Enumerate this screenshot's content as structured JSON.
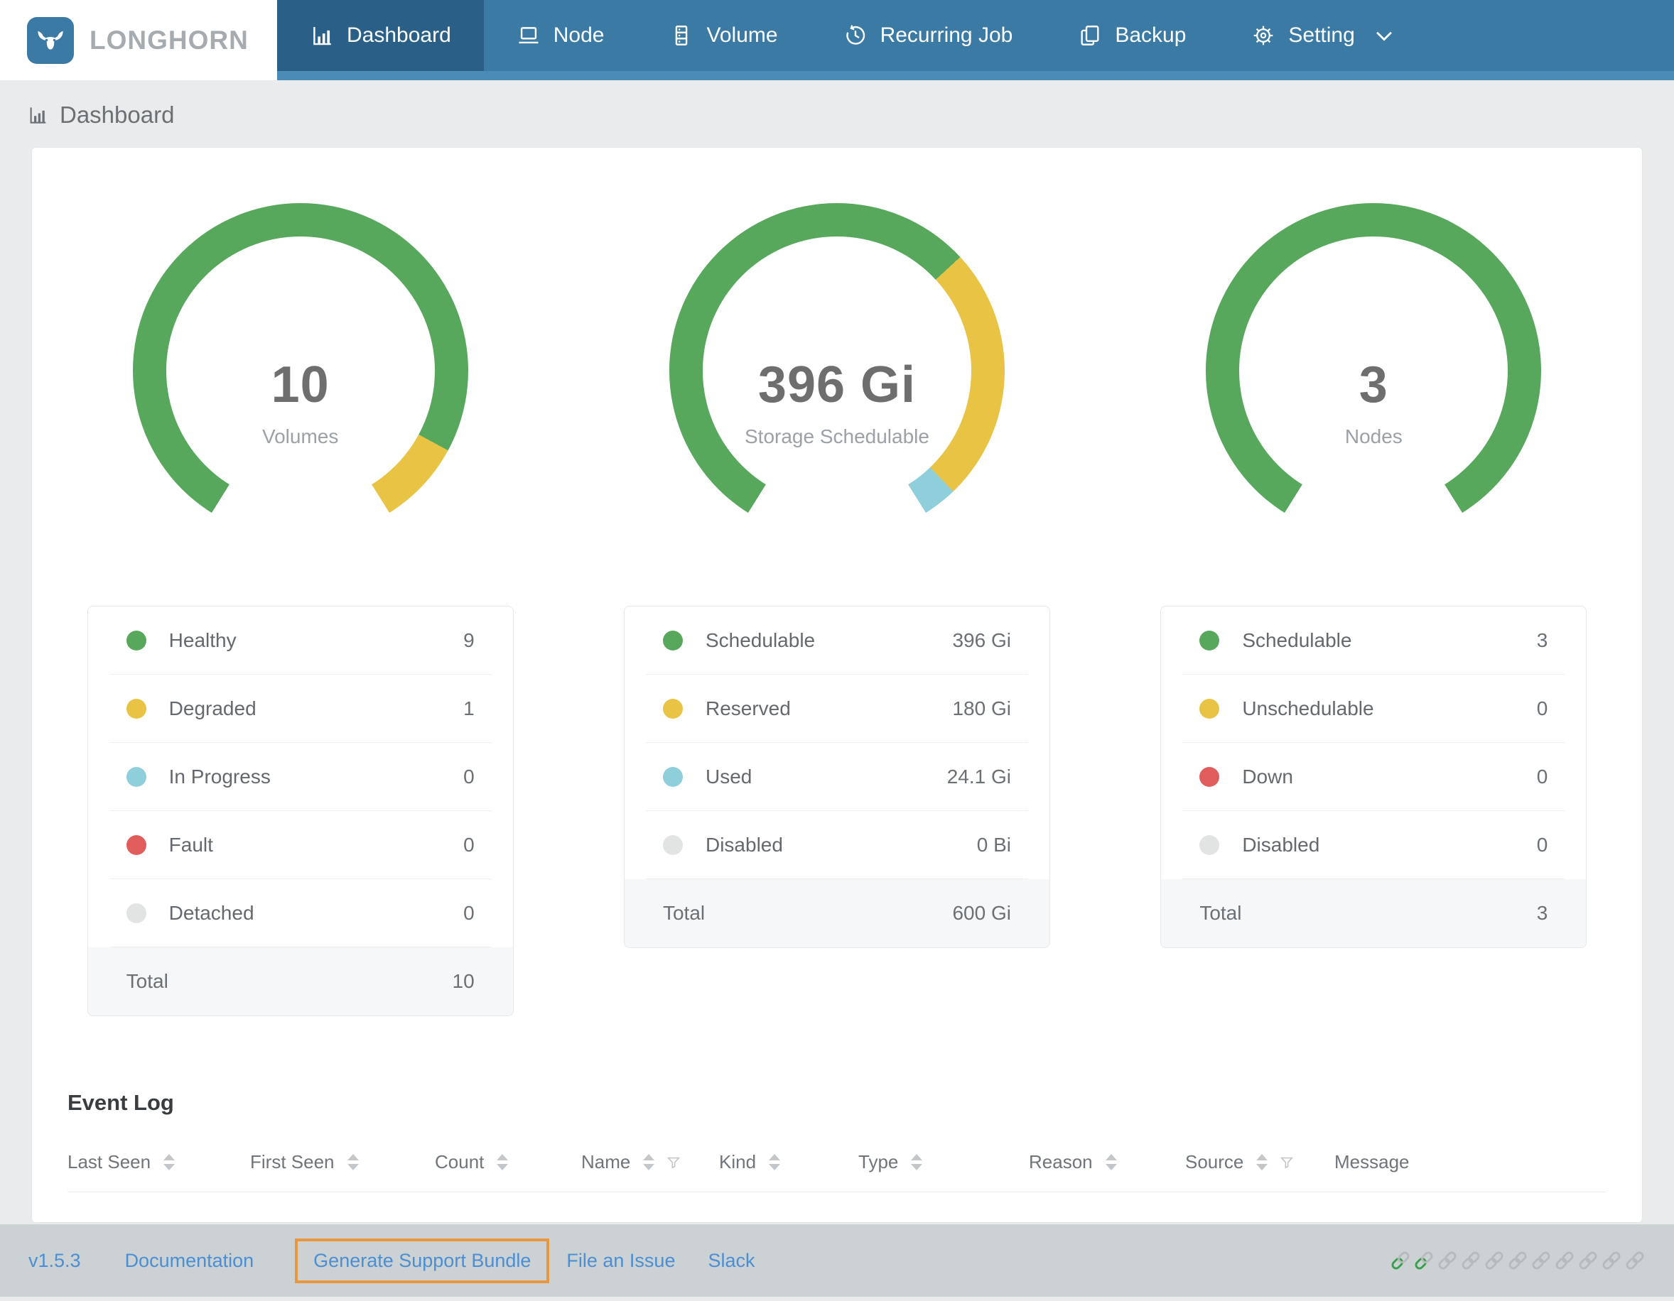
{
  "nav": {
    "brand": "LONGHORN",
    "items": [
      {
        "label": "Dashboard",
        "icon": "bar-chart-icon",
        "active": true
      },
      {
        "label": "Node",
        "icon": "laptop-icon",
        "active": false
      },
      {
        "label": "Volume",
        "icon": "server-icon",
        "active": false
      },
      {
        "label": "Recurring Job",
        "icon": "clock-icon",
        "active": false
      },
      {
        "label": "Backup",
        "icon": "copy-icon",
        "active": false
      },
      {
        "label": "Setting",
        "icon": "gear-icon",
        "active": false,
        "has_dropdown": true
      }
    ]
  },
  "page_title": "Dashboard",
  "chart_data": [
    {
      "type": "pie",
      "title": "Volumes",
      "center_value": "10",
      "segments": [
        {
          "label": "Healthy",
          "value": 9,
          "color": "#57a85c"
        },
        {
          "label": "Degraded",
          "value": 1,
          "color": "#e9c344"
        },
        {
          "label": "In Progress",
          "value": 0,
          "color": "#8fcfdc"
        },
        {
          "label": "Fault",
          "value": 0,
          "color": "#e05d5b"
        },
        {
          "label": "Detached",
          "value": 0,
          "color": "#e2e4e4"
        }
      ],
      "total": 10
    },
    {
      "type": "pie",
      "title": "Storage Schedulable",
      "center_value": "396 Gi",
      "segments": [
        {
          "label": "Schedulable",
          "value": 396,
          "color": "#57a85c"
        },
        {
          "label": "Reserved",
          "value": 180,
          "color": "#e9c344"
        },
        {
          "label": "Used",
          "value": 24.1,
          "color": "#8fcfdc"
        },
        {
          "label": "Disabled",
          "value": 0,
          "color": "#e2e4e4"
        }
      ],
      "total": "600 Gi"
    },
    {
      "type": "pie",
      "title": "Nodes",
      "center_value": "3",
      "segments": [
        {
          "label": "Schedulable",
          "value": 3,
          "color": "#57a85c"
        },
        {
          "label": "Unschedulable",
          "value": 0,
          "color": "#e9c344"
        },
        {
          "label": "Down",
          "value": 0,
          "color": "#e05d5b"
        },
        {
          "label": "Disabled",
          "value": 0,
          "color": "#e2e4e4"
        }
      ],
      "total": 3
    }
  ],
  "gauges": [
    {
      "value": "10",
      "label": "Volumes",
      "arc": {
        "from_deg": 212,
        "segments": [
          {
            "color": "#57a85c",
            "deg": 266.4
          },
          {
            "color": "#e9c344",
            "deg": 29.6
          }
        ]
      },
      "rows": [
        {
          "name": "Healthy",
          "value": "9",
          "color": "#57a85c"
        },
        {
          "name": "Degraded",
          "value": "1",
          "color": "#e9c344"
        },
        {
          "name": "In Progress",
          "value": "0",
          "color": "#8fcfdc"
        },
        {
          "name": "Fault",
          "value": "0",
          "color": "#e05d5b"
        },
        {
          "name": "Detached",
          "value": "0",
          "color": "#e2e4e4"
        }
      ],
      "total_label": "Total",
      "total_value": "10"
    },
    {
      "value": "396 Gi",
      "label": "Storage Schedulable",
      "arc": {
        "from_deg": 212,
        "segments": [
          {
            "color": "#57a85c",
            "deg": 195.3
          },
          {
            "color": "#e9c344",
            "deg": 88.8
          },
          {
            "color": "#8fcfdc",
            "deg": 11.9
          }
        ]
      },
      "rows": [
        {
          "name": "Schedulable",
          "value": "396 Gi",
          "color": "#57a85c"
        },
        {
          "name": "Reserved",
          "value": "180 Gi",
          "color": "#e9c344"
        },
        {
          "name": "Used",
          "value": "24.1 Gi",
          "color": "#8fcfdc"
        },
        {
          "name": "Disabled",
          "value": "0 Bi",
          "color": "#e2e4e4"
        }
      ],
      "total_label": "Total",
      "total_value": "600 Gi"
    },
    {
      "value": "3",
      "label": "Nodes",
      "arc": {
        "from_deg": 212,
        "segments": [
          {
            "color": "#57a85c",
            "deg": 296
          }
        ]
      },
      "rows": [
        {
          "name": "Schedulable",
          "value": "3",
          "color": "#57a85c"
        },
        {
          "name": "Unschedulable",
          "value": "0",
          "color": "#e9c344"
        },
        {
          "name": "Down",
          "value": "0",
          "color": "#e05d5b"
        },
        {
          "name": "Disabled",
          "value": "0",
          "color": "#e2e4e4"
        }
      ],
      "total_label": "Total",
      "total_value": "3"
    }
  ],
  "event_log": {
    "title": "Event Log",
    "columns": [
      {
        "label": "Last Seen",
        "sortable": true,
        "filterable": false
      },
      {
        "label": "First Seen",
        "sortable": true,
        "filterable": false
      },
      {
        "label": "Count",
        "sortable": true,
        "filterable": false
      },
      {
        "label": "Name",
        "sortable": true,
        "filterable": true
      },
      {
        "label": "Kind",
        "sortable": true,
        "filterable": false
      },
      {
        "label": "Type",
        "sortable": true,
        "filterable": false
      },
      {
        "label": "Reason",
        "sortable": true,
        "filterable": false
      },
      {
        "label": "Source",
        "sortable": true,
        "filterable": true
      },
      {
        "label": "Message",
        "sortable": false,
        "filterable": false
      }
    ]
  },
  "footer": {
    "version": "v1.5.3",
    "links": {
      "documentation": "Documentation",
      "support_bundle": "Generate Support Bundle",
      "file_issue": "File an Issue",
      "slack": "Slack"
    },
    "highlighted_link": "Generate Support Bundle",
    "chain_links": [
      "green",
      "green",
      "gray",
      "gray",
      "gray",
      "gray",
      "gray",
      "gray",
      "gray",
      "gray",
      "gray"
    ]
  },
  "colors": {
    "navbar": "#3a7aa4",
    "navbar_active": "#2a5f88",
    "navbar_underline": "#4a8cb6",
    "accent_green": "#57a85c",
    "accent_yellow": "#e9c344",
    "accent_blue": "#8fcfdc",
    "accent_red": "#e05d5b",
    "accent_gray": "#e2e4e4",
    "link_blue": "#4a8fd4",
    "highlight_orange": "#e9973e",
    "chain_green": "#35a04a",
    "chain_gray": "#b7babd"
  }
}
